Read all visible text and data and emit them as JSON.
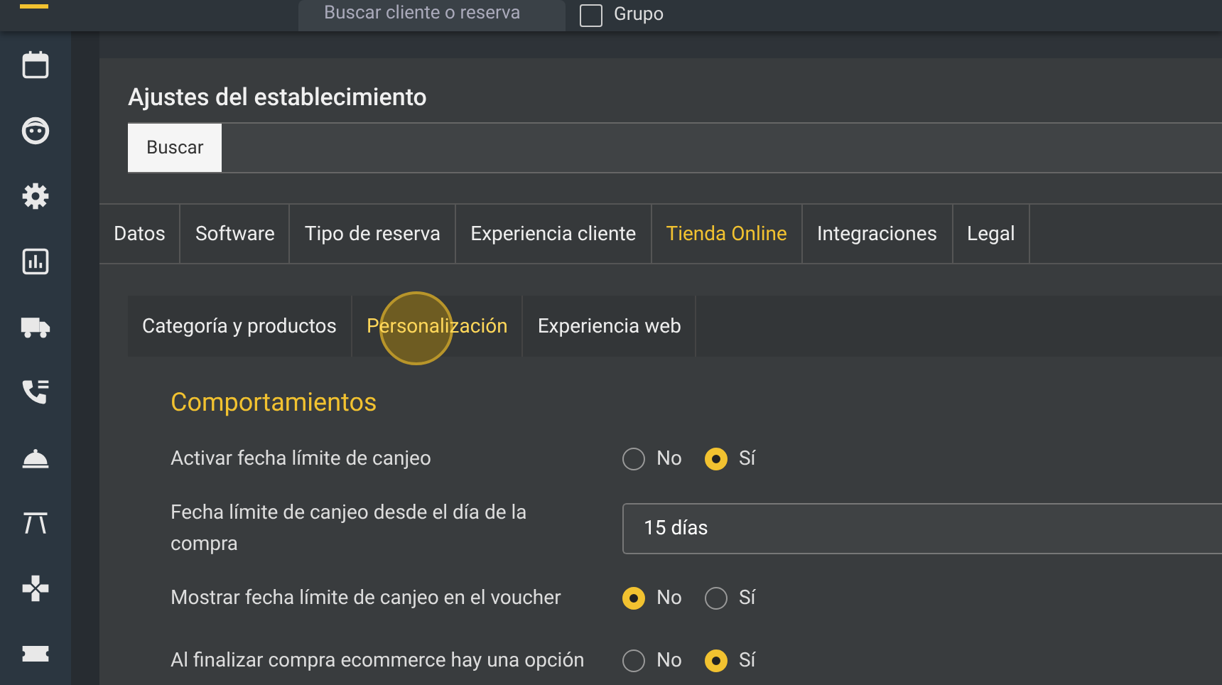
{
  "topbar": {
    "search": {
      "placeholder": "Buscar cliente o reserva"
    },
    "group_checkbox": {
      "label": "Grupo",
      "checked": false
    }
  },
  "sidebar": {
    "items": [
      {
        "kind": "calendar"
      },
      {
        "kind": "face"
      },
      {
        "kind": "settings"
      },
      {
        "kind": "chart"
      },
      {
        "kind": "truck"
      },
      {
        "kind": "phone"
      },
      {
        "kind": "bell"
      },
      {
        "kind": "table"
      },
      {
        "kind": "gamepad"
      },
      {
        "kind": "ticket"
      }
    ]
  },
  "panel": {
    "title": "Ajustes del establecimiento",
    "search_button": "Buscar",
    "tabs": [
      {
        "label": "Datos",
        "selected": false
      },
      {
        "label": "Software",
        "selected": false
      },
      {
        "label": "Tipo de reserva",
        "selected": false
      },
      {
        "label": "Experiencia cliente",
        "selected": false
      },
      {
        "label": "Tienda Online",
        "selected": true
      },
      {
        "label": "Integraciones",
        "selected": false
      },
      {
        "label": "Legal",
        "selected": false
      }
    ],
    "subtabs": [
      {
        "label": "Categoría y productos",
        "selected": false
      },
      {
        "label": "Personalización",
        "selected": true
      },
      {
        "label": "Experiencia web",
        "selected": false
      }
    ],
    "section_title": "Comportamientos",
    "settings": [
      {
        "kind": "radio",
        "label": "Activar fecha límite de canjeo",
        "options": [
          {
            "label": "No",
            "selected": false
          },
          {
            "label": "Sí",
            "selected": true
          }
        ]
      },
      {
        "kind": "select",
        "label": "Fecha límite de canjeo desde el día de la compra",
        "value": "15 días"
      },
      {
        "kind": "radio",
        "label": "Mostrar fecha límite de canjeo en el voucher",
        "options": [
          {
            "label": "No",
            "selected": true
          },
          {
            "label": "Sí",
            "selected": false
          }
        ]
      },
      {
        "kind": "radio",
        "label": "Al finalizar compra ecommerce hay una opción",
        "options": [
          {
            "label": "No",
            "selected": false
          },
          {
            "label": "Sí",
            "selected": true
          }
        ]
      }
    ]
  }
}
